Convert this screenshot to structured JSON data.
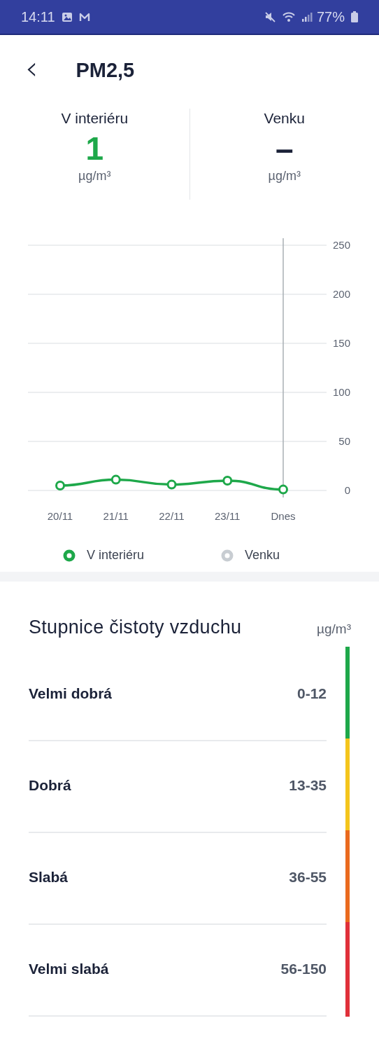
{
  "status_bar": {
    "time": "14:11",
    "battery": "77%"
  },
  "header": {
    "back": "‹",
    "title": "PM2,5"
  },
  "readings": [
    {
      "label": "V interiéru",
      "value": "1",
      "unit": "µg/m³",
      "color": "#1ea84a"
    },
    {
      "label": "Venku",
      "value": "–",
      "unit": "µg/m³",
      "color": "#1b2238"
    }
  ],
  "chart": {
    "chart_data": {
      "type": "line",
      "categories": [
        "20/11",
        "21/11",
        "22/11",
        "23/11",
        "Dnes"
      ],
      "ylim": [
        0,
        250
      ],
      "grid": true,
      "ref_lines": [
        {
          "axis": "x",
          "value": "Dnes",
          "color": "#a9afb5"
        }
      ],
      "yticks": [
        0,
        50,
        100,
        150,
        200,
        250
      ],
      "series": [
        {
          "name": "V interiéru",
          "color": "#1ea84a",
          "values": [
            5,
            11,
            6,
            10,
            1
          ],
          "marker": "circle"
        },
        {
          "name": "Venku",
          "color": "#c8cdd2",
          "values": [
            null,
            null,
            null,
            null,
            null
          ]
        }
      ]
    }
  },
  "scale": {
    "title": "Stupnice čistoty vzduchu",
    "unit": "µg/m³",
    "levels": [
      {
        "label": "Velmi dobrá",
        "range": "0-12",
        "color": "#1ea84a"
      },
      {
        "label": "Dobrá",
        "range": "13-35",
        "color": "#f4c51c"
      },
      {
        "label": "Slabá",
        "range": "36-55",
        "color": "#ea6a1e"
      },
      {
        "label": "Velmi slabá",
        "range": "56-150",
        "color": "#e0303a"
      }
    ]
  }
}
